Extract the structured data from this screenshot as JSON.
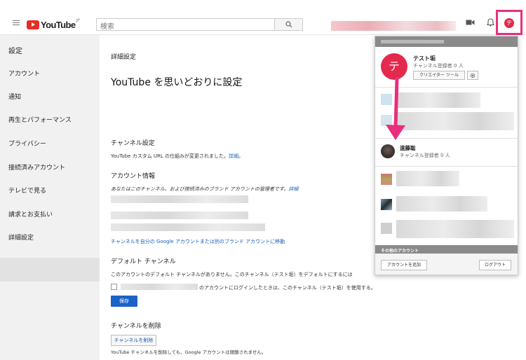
{
  "header": {
    "logo_text": "YouTube",
    "logo_region": "JP",
    "search_placeholder": "検索",
    "highlight_color": "#ea2e7f",
    "avatar_initial": "テ"
  },
  "sidebar": {
    "items": [
      {
        "label": "設定"
      },
      {
        "label": "アカウント"
      },
      {
        "label": "通知"
      },
      {
        "label": "再生とパフォーマンス"
      },
      {
        "label": "プライバシー"
      },
      {
        "label": "接続済みアカウント"
      },
      {
        "label": "テレビで見る"
      },
      {
        "label": "請求とお支払い"
      },
      {
        "label": "詳細設定"
      }
    ],
    "active": "詳細設定"
  },
  "main": {
    "title": "詳細設定",
    "heading": "YouTube を思いどおりに設定",
    "channel_settings": {
      "label": "チャンネル設定",
      "text": "YouTube カスタム URL の仕組みが変更されました。",
      "link": "詳細",
      "after": "。"
    },
    "account_info": {
      "label": "アカウント情報",
      "text": "あなたはこのチャンネル、および接続済みのブランド アカウントの管理者です。",
      "link": "詳細",
      "move_link": "チャンネルを自分の Google アカウントまたは別のブランド アカウントに移動"
    },
    "default_channel": {
      "label": "デフォルト チャンネル",
      "text": "このアカウントのデフォルト チャンネルがありません。このチャンネル（テスト垢）をデフォルトにするには",
      "checkbox_text": "のアカウントにログインしたときは、このチャンネル（テスト垢）を使用する。",
      "save": "保存"
    },
    "delete_channel": {
      "label": "チャンネルを削除",
      "button": "チャンネルを削除",
      "note": "YouTube チャンネルを削除しても、Google アカウントは閉鎖されません。"
    }
  },
  "popup": {
    "current_name": "テスト垢",
    "current_sub": "チャンネル登録者 0 人",
    "creator_tool": "クリエイター ツール",
    "other_account_name": "遠藤聡",
    "other_account_sub": "チャンネル登録者 0 人",
    "other_accounts_header": "その他のアカウント",
    "add_account": "アカウントを追加",
    "logout": "ログアウト"
  }
}
